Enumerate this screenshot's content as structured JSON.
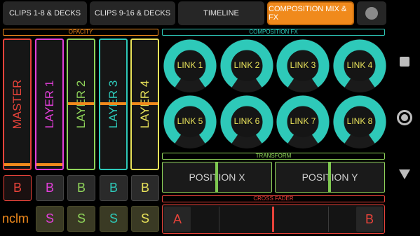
{
  "tabs": [
    {
      "label": "CLIPS 1-8 & DECKS"
    },
    {
      "label": "CLIPS 9-16 & DECKS"
    },
    {
      "label": "TIMELINE"
    },
    {
      "label": "COMPOSITION MIX & FX",
      "active": true
    }
  ],
  "sections": {
    "opacity": "OPACITY",
    "composition_fx": "COMPOSITION FX",
    "transform": "TRANSFORM",
    "cross_fader": "CROSS FADER"
  },
  "faders": [
    {
      "label": "MASTER",
      "color": "#e8433a",
      "level": 1.0
    },
    {
      "label": "LAYER 1",
      "color": "#e23fd9",
      "level": 1.0
    },
    {
      "label": "LAYER 2",
      "color": "#8fd45a",
      "level": 0.5
    },
    {
      "label": "LAYER 3",
      "color": "#2ec9b9",
      "level": 0.5
    },
    {
      "label": "LAYER 4",
      "color": "#e8e25a",
      "level": 0.5
    }
  ],
  "bypass_buttons": [
    {
      "label": "B",
      "color": "#e8433a"
    },
    {
      "label": "B",
      "color": "#e23fd9"
    },
    {
      "label": "B",
      "color": "#8fd45a"
    },
    {
      "label": "B",
      "color": "#2ec9b9"
    },
    {
      "label": "B",
      "color": "#e8e25a"
    }
  ],
  "logo": "nclm",
  "solo_buttons": [
    {
      "label": "S",
      "color": "#e23fd9"
    },
    {
      "label": "S",
      "color": "#8fd45a"
    },
    {
      "label": "S",
      "color": "#2ec9b9"
    },
    {
      "label": "S",
      "color": "#e8e25a"
    }
  ],
  "links": [
    {
      "label": "LINK 1"
    },
    {
      "label": "LINK 2"
    },
    {
      "label": "LINK 3"
    },
    {
      "label": "LINK 4"
    },
    {
      "label": "LINK 5"
    },
    {
      "label": "LINK 6"
    },
    {
      "label": "LINK 7"
    },
    {
      "label": "LINK 8"
    }
  ],
  "positions": [
    {
      "label": "POSITION X",
      "value": 0.5
    },
    {
      "label": "POSITION Y",
      "value": 0.5
    }
  ],
  "crossfader": {
    "a_label": "A",
    "b_label": "B",
    "value": 0.5
  },
  "colors": {
    "accent": "#f08a1c",
    "composition": "#2ec9b9",
    "transform": "#8fd45a",
    "crossfader": "#e8433a"
  }
}
